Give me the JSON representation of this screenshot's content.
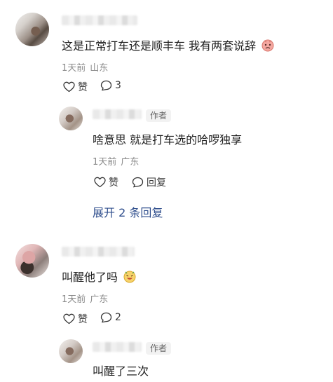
{
  "comments": [
    {
      "text": "这是正常打车还是顺丰车 我有两套说辞",
      "emoji": "sad-face-emoji",
      "time": "1天前",
      "location": "山东",
      "like_label": "赞",
      "reply_count": "3",
      "replies": [
        {
          "author_tag": "作者",
          "text": "啥意思 就是打车选的哈啰独享",
          "time": "1天前",
          "location": "广东",
          "like_label": "赞",
          "reply_label": "回复"
        }
      ],
      "expand_label": "展开 2 条回复"
    },
    {
      "text": "叫醒他了吗",
      "emoji": "laughing-face-emoji",
      "time": "1天前",
      "location": "广东",
      "like_label": "赞",
      "reply_count": "2",
      "replies": [
        {
          "author_tag": "作者",
          "text": "叫醒了三次"
        }
      ]
    }
  ],
  "colors": {
    "text": "#1f1f1f",
    "meta": "#8a8a8a",
    "link": "#2e4d8c",
    "tag_bg": "#f2f2f2"
  }
}
